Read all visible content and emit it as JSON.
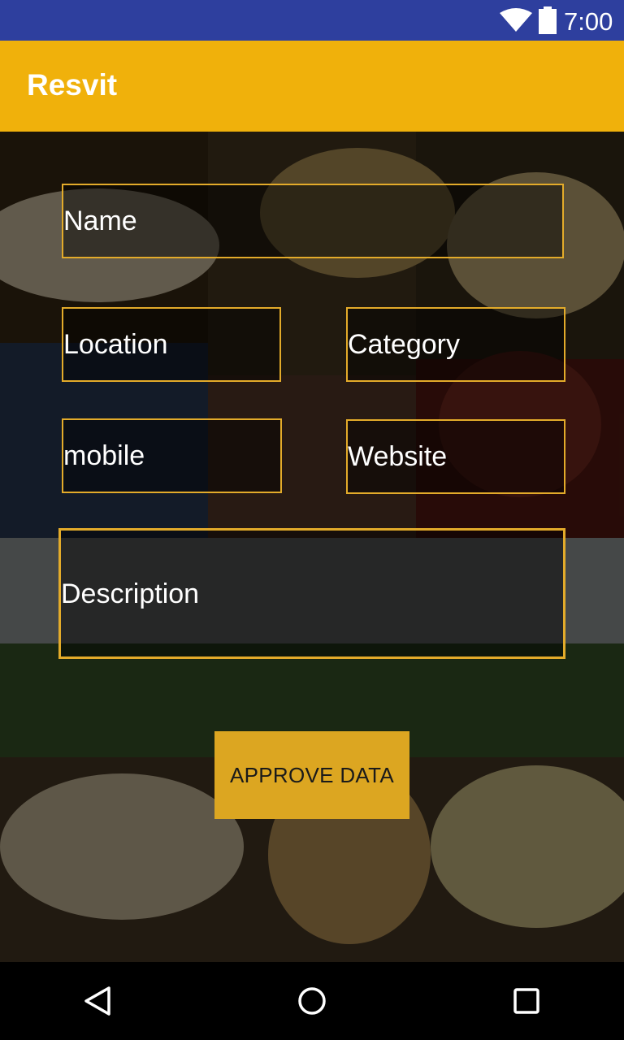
{
  "status_bar": {
    "time": "7:00"
  },
  "app_bar": {
    "title": "Resvit"
  },
  "form": {
    "name_placeholder": "Name",
    "location_placeholder": "Location",
    "category_placeholder": "Category",
    "mobile_placeholder": "mobile",
    "website_placeholder": "Website",
    "description_placeholder": "Description",
    "approve_label": "APPROVE DATA"
  },
  "colors": {
    "status_bar": "#2e3f9e",
    "app_bar": "#f0b10b",
    "field_border": "#e3ab2a",
    "button": "#dca621"
  },
  "icons": {
    "status": [
      "wifi-icon",
      "battery-icon"
    ],
    "nav": [
      "back-icon",
      "home-icon",
      "recents-icon"
    ]
  }
}
